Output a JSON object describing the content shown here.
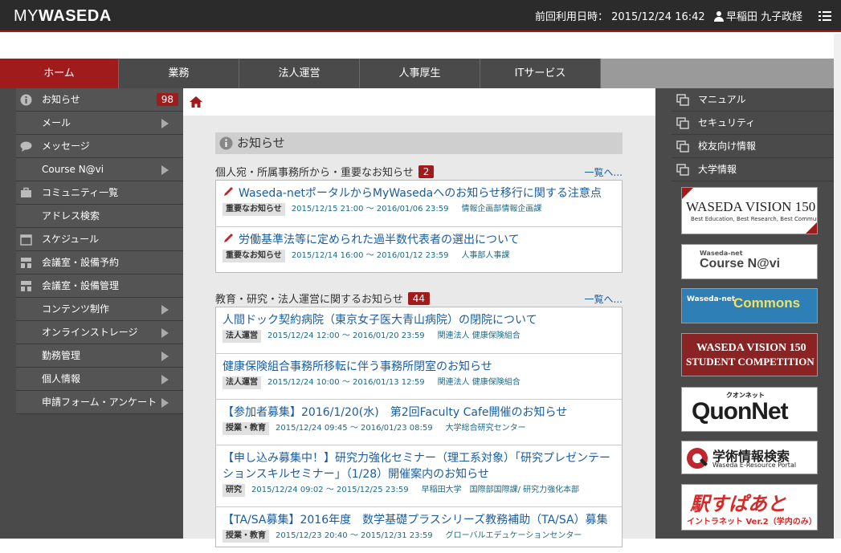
{
  "header": {
    "logo_my": "MY",
    "logo_waseda": "WASEDA",
    "last_login": "前回利用日時： 2015/12/24 16:42",
    "user_name": "早稲田 九子政経"
  },
  "tabs": [
    {
      "label": "ホーム",
      "active": true
    },
    {
      "label": "業務"
    },
    {
      "label": "法人運営"
    },
    {
      "label": "人事厚生"
    },
    {
      "label": "ITサービス"
    }
  ],
  "left_nav": [
    {
      "label": "お知らせ",
      "icon": "info-icon",
      "badge": "98"
    },
    {
      "label": "メール",
      "arrow": true
    },
    {
      "label": "メッセージ",
      "icon": "speech-bubble-icon"
    },
    {
      "label": "Course N@vi",
      "arrow": true
    },
    {
      "label": "コミュニティ一覧",
      "icon": "briefcase-icon"
    },
    {
      "label": "アドレス検索"
    },
    {
      "label": "スケジュール",
      "icon": "calendar-icon"
    },
    {
      "label": "会議室・設備予約",
      "icon": "building-icon"
    },
    {
      "label": "会議室・設備管理",
      "icon": "building-icon"
    },
    {
      "label": "コンテンツ制作",
      "arrow": true
    },
    {
      "label": "オンラインストレージ",
      "arrow": true
    },
    {
      "label": "勤務管理",
      "arrow": true
    },
    {
      "label": "個人情報",
      "arrow": true
    },
    {
      "label": "申請フォーム・アンケート",
      "arrow": true
    }
  ],
  "main": {
    "section_title": "お知らせ",
    "groups": [
      {
        "heading": "個人宛・所属事務所から・重要なお知らせ",
        "count": "2",
        "more": "一覧へ...",
        "items": [
          {
            "title": "Waseda-netポータルからMyWasedaへのお知らせ移行に関する注意点",
            "tag": "重要なお知らせ",
            "date": "2015/12/15 21:00 ～ 2016/01/06 23:59",
            "dept": "情報企画部情報企画課",
            "pen": true
          },
          {
            "title": "労働基準法等に定められた過半数代表者の選出について",
            "tag": "重要なお知らせ",
            "date": "2015/12/14 16:00 ～ 2016/01/12 23:59",
            "dept": "人事部人事課",
            "pen": true
          }
        ]
      },
      {
        "heading": "教育・研究・法人運営に関するお知らせ",
        "count": "44",
        "more": "一覧へ...",
        "items": [
          {
            "title": "人間ドック契約病院（東京女子医大青山病院）の閉院について",
            "tag": "法人運営",
            "date": "2015/12/24 12:00 ～ 2016/01/20 23:59",
            "dept": "関連法人 健康保険組合"
          },
          {
            "title": "健康保険組合事務所移転に伴う事務所閉室のお知らせ",
            "tag": "法人運営",
            "date": "2015/12/24 10:00 ～ 2016/01/13 12:59",
            "dept": "関連法人 健康保険組合"
          },
          {
            "title": "【参加者募集】2016/1/20(水)　第2回Faculty Cafe開催のお知らせ",
            "tag": "授業・教育",
            "date": "2015/12/24 09:45 ～ 2016/01/23 08:59",
            "dept": "大学総合研究センター"
          },
          {
            "title": "【申し込み募集中！】研究力強化セミナー（理工系対象）「研究プレゼンテーションスキルセミナー」（1/28）開催案内のお知らせ",
            "tag": "研究",
            "date": "2015/12/24 09:02 ～ 2015/12/25 23:59",
            "dept": "早稲田大学　国際部国際課/ 研究力強化本部"
          },
          {
            "title": "【TA/SA募集】2016年度　数学基礎プラスシリーズ教務補助（TA/SA）募集",
            "tag": "授業・教育",
            "date": "2015/12/23 20:40 ～ 2015/12/31 23:59",
            "dept": "グローバルエデュケーションセンター"
          }
        ]
      }
    ]
  },
  "right_nav": [
    {
      "label": "マニュアル",
      "icon": "external-window-icon"
    },
    {
      "label": "セキュリティ",
      "icon": "external-window-icon"
    },
    {
      "label": "校友向け情報",
      "icon": "external-window-icon"
    },
    {
      "label": "大学情報",
      "icon": "external-window-icon"
    }
  ],
  "banners": {
    "vision150": {
      "title": "WASEDA VISION 150",
      "sub": "Best Education, Best Research, Best Community"
    },
    "coursenavi": {
      "top": "Waseda-net",
      "main": "Course N@vi"
    },
    "commons": {
      "top": "Waseda-net",
      "main": "Commons"
    },
    "competition": {
      "line1": "WASEDA VISION 150",
      "line2": "STUDENT COMPETITION"
    },
    "quonnet": {
      "kana": "クオンネット",
      "main": "QuonNet"
    },
    "eresource": {
      "main": "学術情報検索",
      "sub": "Waseda E-Resource Portal"
    },
    "ekispert": {
      "main": "駅すぱあと",
      "sub": "イントラネット Ver.2（学内のみ）"
    }
  },
  "colors": {
    "accent": "#a01c1c",
    "nav_bg": "#4a4a4a",
    "link": "#1a5c9e"
  }
}
